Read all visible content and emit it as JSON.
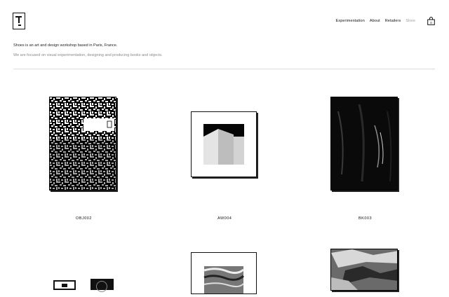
{
  "nav": {
    "items": [
      "Experimentation",
      "About",
      "Retailers",
      "Store"
    ]
  },
  "intro": {
    "line1": "Shoes is an art and design workshop based in Paris, France.",
    "line2": "We are focused on visual experimentation, designing and producing books and objects."
  },
  "products": [
    {
      "code": "OBJ002"
    },
    {
      "code": "AW004"
    },
    {
      "code": "BK003"
    }
  ]
}
